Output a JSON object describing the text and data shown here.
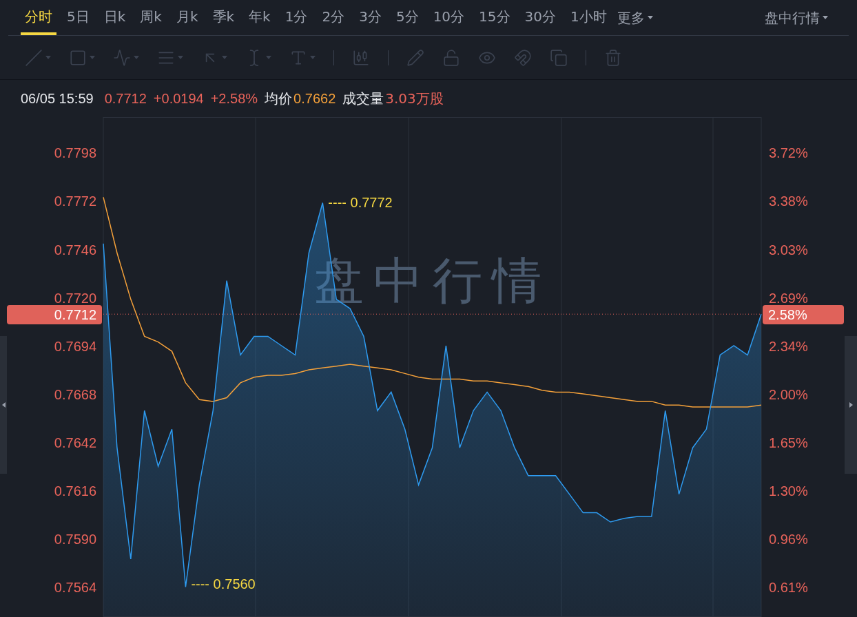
{
  "tabs": [
    {
      "label": "分时",
      "selected": true
    },
    {
      "label": "5日",
      "selected": false
    },
    {
      "label": "日k",
      "selected": false
    },
    {
      "label": "周k",
      "selected": false
    },
    {
      "label": "月k",
      "selected": false
    },
    {
      "label": "季k",
      "selected": false
    },
    {
      "label": "年k",
      "selected": false
    },
    {
      "label": "1分",
      "selected": false
    },
    {
      "label": "2分",
      "selected": false
    },
    {
      "label": "3分",
      "selected": false
    },
    {
      "label": "5分",
      "selected": false
    },
    {
      "label": "10分",
      "selected": false
    },
    {
      "label": "15分",
      "selected": false
    },
    {
      "label": "30分",
      "selected": false
    },
    {
      "label": "1小时",
      "selected": false
    }
  ],
  "more_menu": {
    "label": "更多"
  },
  "mode_menu": {
    "label": "盘中行情"
  },
  "header": {
    "datetime": "06/05 15:59",
    "price": "0.7712",
    "change": "+0.0194",
    "change_pct": "+2.58%",
    "avg_label": "均价",
    "avg_value": "0.7662",
    "volume_label": "成交量",
    "volume_value": "3.03万股"
  },
  "chart": {
    "watermark": "盘中行情",
    "current_price_tag": "0.7712",
    "current_pct_tag": "2.58%",
    "max_label": "---- 0.7772",
    "min_label": "---- 0.7560",
    "right_axis_labels": [
      "3.72%",
      "3.38%",
      "3.03%",
      "2.69%",
      "2.34%",
      "2.00%",
      "1.65%",
      "1.30%",
      "0.96%",
      "0.61%"
    ],
    "chart_data": {
      "type": "line",
      "ylim": [
        0.7549,
        0.7818
      ],
      "yticks": [
        {
          "value": 0.7798,
          "label": "0.7798"
        },
        {
          "value": 0.7772,
          "label": "0.7772"
        },
        {
          "value": 0.7746,
          "label": "0.7746"
        },
        {
          "value": 0.772,
          "label": "0.7720"
        },
        {
          "value": 0.7694,
          "label": "0.7694"
        },
        {
          "value": 0.7668,
          "label": "0.7668"
        },
        {
          "value": 0.7642,
          "label": "0.7642"
        },
        {
          "value": 0.7616,
          "label": "0.7616"
        },
        {
          "value": 0.759,
          "label": "0.7590"
        },
        {
          "value": 0.7564,
          "label": "0.7564"
        }
      ],
      "series": [
        {
          "color": "#2e9bf0",
          "values": [
            0.775,
            0.764,
            0.758,
            0.766,
            0.763,
            0.765,
            0.7565,
            0.762,
            0.766,
            0.773,
            0.769,
            0.77,
            0.77,
            0.7695,
            0.769,
            0.7745,
            0.7772,
            0.772,
            0.7715,
            0.77,
            0.766,
            0.767,
            0.765,
            0.762,
            0.764,
            0.7695,
            0.764,
            0.766,
            0.767,
            0.766,
            0.764,
            0.7625,
            0.7625,
            0.7625,
            0.7615,
            0.7605,
            0.7605,
            0.76,
            0.7602,
            0.7603,
            0.7603,
            0.766,
            0.7615,
            0.764,
            0.765,
            0.769,
            0.7695,
            0.769,
            0.7712
          ]
        },
        {
          "color": "#f5a13a",
          "values": [
            0.7775,
            0.7745,
            0.772,
            0.77,
            0.7697,
            0.7692,
            0.7675,
            0.7666,
            0.7665,
            0.7667,
            0.7675,
            0.7678,
            0.7679,
            0.7679,
            0.768,
            0.7682,
            0.7683,
            0.7684,
            0.7685,
            0.7684,
            0.7683,
            0.7682,
            0.768,
            0.7678,
            0.7677,
            0.7677,
            0.7677,
            0.7676,
            0.7676,
            0.7675,
            0.7674,
            0.7673,
            0.7671,
            0.767,
            0.767,
            0.7669,
            0.7668,
            0.7667,
            0.7666,
            0.7665,
            0.7665,
            0.7663,
            0.7663,
            0.7662,
            0.7662,
            0.7662,
            0.7662,
            0.7662,
            0.7663
          ]
        }
      ]
    }
  }
}
